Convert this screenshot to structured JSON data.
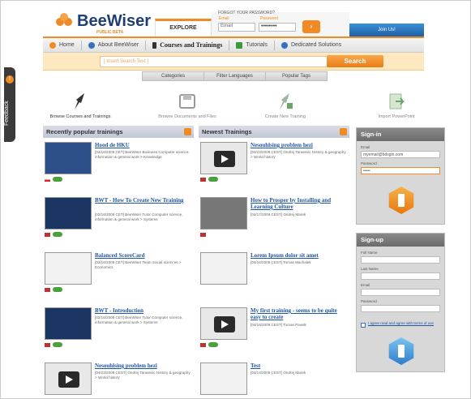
{
  "header": {
    "logo_text": "BeeWiser",
    "logo_sub": "PUBLIC BETA",
    "explore_tab": "EXPLORE",
    "forgot_link": "FORGOT YOUR PASSWORD?",
    "email_label": "Email",
    "password_label": "Password",
    "email_value": "Email",
    "password_value": "••••••••",
    "join_label": "Join Us!"
  },
  "nav": {
    "items": [
      {
        "label": "Home"
      },
      {
        "label": "About BeeWiser"
      },
      {
        "label": "Courses and Trainings"
      },
      {
        "label": "Tutorials"
      },
      {
        "label": "Dedicated Solutions"
      }
    ]
  },
  "search": {
    "placeholder": "[ Insert Search Text ]",
    "button": "Search",
    "tabs": [
      "Categories",
      "Filter Languages",
      "Popular Tags"
    ]
  },
  "side_tab": {
    "label": "Feedback"
  },
  "actions": [
    {
      "label": "Browse Courses and Trainings"
    },
    {
      "label": "Browse Documents and Files"
    },
    {
      "label": "Create New Training"
    },
    {
      "label": "Import PowerPoint"
    }
  ],
  "recent": {
    "heading": "Recently popular trainings",
    "items": [
      {
        "title": "Hood de HKU",
        "meta": "[02/16/2009 CET] BeeWiser Business Computer science, information & general work > Knowledge"
      },
      {
        "title": "BWT - How To Create New Training",
        "meta": "[02/16/2009 CET] BeeWiser Tutor Computer science, information & general work > Systems"
      },
      {
        "title": "Balanced ScoreCard",
        "meta": "[02/16/2009 CET] BeeWiser Team Social sciences > Economics"
      },
      {
        "title": "BWT - Introduction",
        "meta": "[02/16/2009 CET] BeeWiser Tutor Computer science, information & general work > Systems"
      },
      {
        "title": "Nesouhlsing problem hezi",
        "meta": "[04/23/2009 CEST] Ondrej Tarasevic History & geography > World history"
      }
    ]
  },
  "newest": {
    "heading": "Newest Trainings",
    "items": [
      {
        "title": "Nesouhlsing problem hezi",
        "meta": "[04/23/2009 CEST] Ondrej Tarasevic History & geography > World history"
      },
      {
        "title": "How to Prosper by Installing and Learning Culture",
        "meta": "[04/17/2009 CEST] Ondrej Marek"
      },
      {
        "title": "Lorem Ipsum dolor sit amet",
        "meta": "[04/16/2009 CEST] Tomas Machalek"
      },
      {
        "title": "My first training - seems to be quite easy to create",
        "meta": "[04/16/2009 CEST] Tomas Pavelk"
      },
      {
        "title": "Test",
        "meta": "[04/14/2009 CEST] Ondrej Marek"
      }
    ]
  },
  "signin": {
    "heading": "Sign-in",
    "email_label": "Email",
    "email_value": "myemail@bdsgin.com",
    "password_label": "Password",
    "password_value": "•••••"
  },
  "signup": {
    "heading": "Sign-up",
    "fields": [
      "Full Name",
      "Last Name",
      "Email",
      "Password"
    ],
    "terms_label": "I agree read and agree with terms of use"
  },
  "colors": {
    "accent": "#f08a24",
    "brand_blue": "#1f3f72",
    "link": "#1f56a5"
  }
}
